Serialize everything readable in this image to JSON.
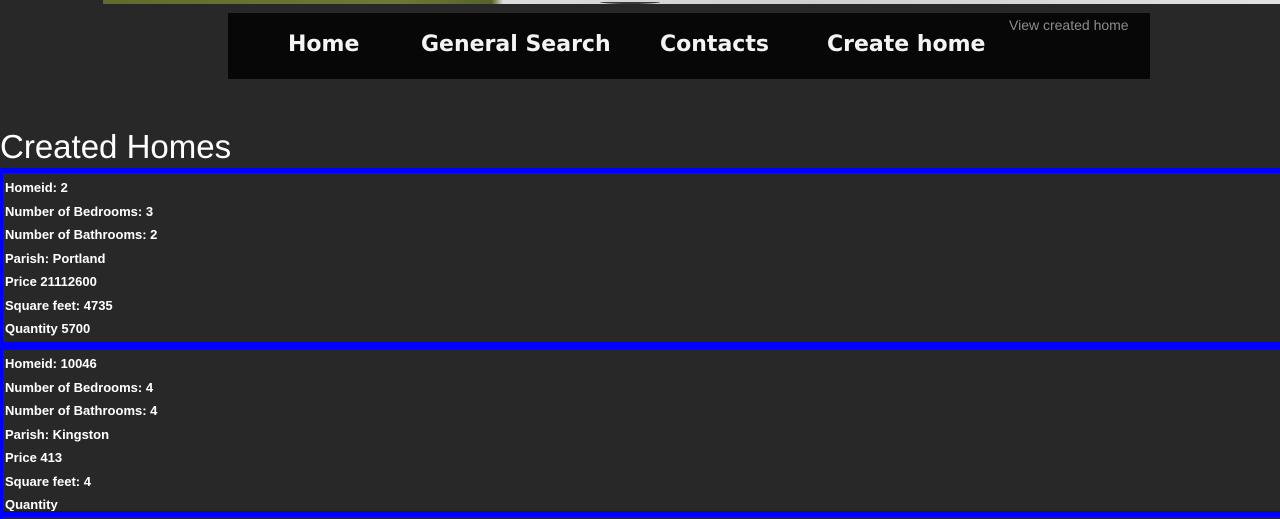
{
  "nav": {
    "home": "Home",
    "general_search": "General Search",
    "contacts": "Contacts",
    "create_home": "Create home",
    "view_created_home": "View created home"
  },
  "page": {
    "title": "Created Homes"
  },
  "homes": [
    {
      "homeid": "Homeid: 2",
      "bedrooms": "Number of Bedrooms: 3",
      "bathrooms": "Number of Bathrooms: 2",
      "parish": "Parish: Portland",
      "price": "Price 21112600",
      "square_feet": "Square feet: 4735",
      "quantity": "Quantity 5700"
    },
    {
      "homeid": "Homeid: 10046",
      "bedrooms": "Number of Bedrooms: 4",
      "bathrooms": "Number of Bathrooms: 4",
      "parish": "Parish: Kingston",
      "price": "Price 413",
      "square_feet": "Square feet: 4",
      "quantity": "Quantity"
    }
  ],
  "colors": {
    "background": "#282828",
    "navbar": "#070707",
    "card_border": "#0000ff",
    "text": "#ffffff",
    "muted_link": "#8c8c8c"
  }
}
